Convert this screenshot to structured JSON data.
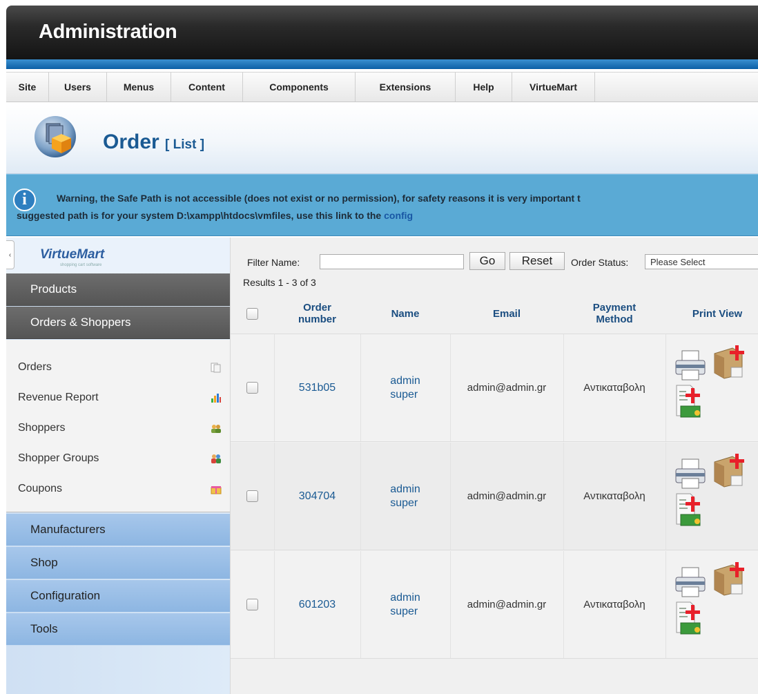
{
  "header": {
    "title": "Administration"
  },
  "menu": {
    "items": [
      {
        "label": "Site",
        "w": 62
      },
      {
        "label": "Users",
        "w": 84
      },
      {
        "label": "Menus",
        "w": 93
      },
      {
        "label": "Content",
        "w": 104
      },
      {
        "label": "Components",
        "w": 163
      },
      {
        "label": "Extensions",
        "w": 145
      },
      {
        "label": "Help",
        "w": 82
      },
      {
        "label": "VirtueMart",
        "w": 120
      }
    ]
  },
  "page": {
    "title": "Order",
    "subtitle": "[ List ]"
  },
  "warning": {
    "line1": "Warning, the Safe Path is not accessible (does not exist or no permission), for safety reasons it is very important t",
    "line2": "suggested path is for your system D:\\xampp\\htdocs\\vmfiles, use this link to the ",
    "link": "config"
  },
  "sidebar": {
    "logo": "VirtueMart",
    "logo_tagline": "shopping cart software",
    "collapse_glyph": "‹",
    "products": "Products",
    "orders_shoppers": "Orders & Shoppers",
    "sub_items": [
      {
        "label": "Orders",
        "icon": "orders-icon"
      },
      {
        "label": "Revenue Report",
        "icon": "revenue-chart-icon"
      },
      {
        "label": "Shoppers",
        "icon": "shoppers-icon"
      },
      {
        "label": "Shopper Groups",
        "icon": "shopper-groups-icon"
      },
      {
        "label": "Coupons",
        "icon": "coupon-gift-icon"
      }
    ],
    "sections": [
      "Manufacturers",
      "Shop",
      "Configuration",
      "Tools"
    ]
  },
  "filters": {
    "filter_label": "Filter Name:",
    "filter_value": "",
    "go": "Go",
    "reset": "Reset",
    "status_label": "Order Status:",
    "status_value": "Please Select",
    "results": "Results 1 - 3 of 3"
  },
  "table": {
    "headers": {
      "order_number_1": "Order",
      "order_number_2": "number",
      "name": "Name",
      "email": "Email",
      "payment_1": "Payment",
      "payment_2": "Method",
      "print_view": "Print View"
    },
    "rows": [
      {
        "order": "531b05",
        "first": "admin",
        "last": "super",
        "email": "admin@admin.gr",
        "payment": "Αντικαταβολη"
      },
      {
        "order": "304704",
        "first": "admin",
        "last": "super",
        "email": "admin@admin.gr",
        "payment": "Αντικαταβολη"
      },
      {
        "order": "601203",
        "first": "admin",
        "last": "super",
        "email": "admin@admin.gr",
        "payment": "Αντικαταβολη"
      }
    ]
  },
  "colors": {
    "header_bg": "#1e1e1e",
    "accent_blue": "#1a5a93",
    "warning_bg": "#5aaad5",
    "sidebar_dark": "#5f5f5f",
    "sidebar_light": "#9cbfe7"
  }
}
